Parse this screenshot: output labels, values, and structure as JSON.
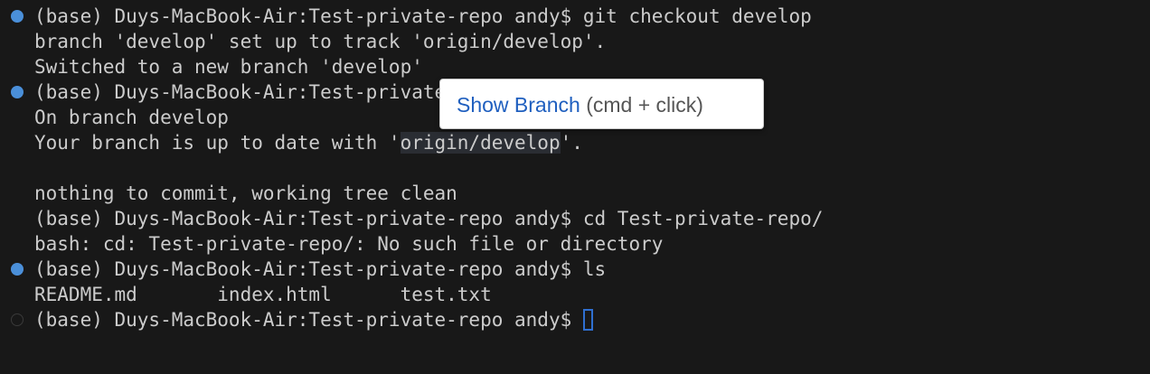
{
  "terminal": {
    "lines": [
      "(base) Duys-MacBook-Air:Test-private-repo andy$ git checkout develop",
      "branch 'develop' set up to track 'origin/develop'.",
      "Switched to a new branch 'develop'",
      "(base) Duys-MacBook-Air:Test-private-repo andy$ git status",
      "On branch develop",
      "Your branch is up to date with '",
      "origin/develop",
      "'.",
      "",
      "nothing to commit, working tree clean",
      "(base) Duys-MacBook-Air:Test-private-repo andy$ cd Test-private-repo/",
      "bash: cd: Test-private-repo/: No such file or directory",
      "(base) Duys-MacBook-Air:Test-private-repo andy$ ls",
      "README.md       index.html      test.txt",
      "(base) Duys-MacBook-Air:Test-private-repo andy$ "
    ]
  },
  "tooltip": {
    "link_label": "Show Branch",
    "hint": " (cmd + click)"
  },
  "colors": {
    "background": "#181818",
    "text": "#cccccc",
    "success_marker": "#4a8fd9",
    "error_marker": "#e5534b",
    "cursor": "#2f6fd0",
    "tooltip_link": "#1f5fbf"
  }
}
